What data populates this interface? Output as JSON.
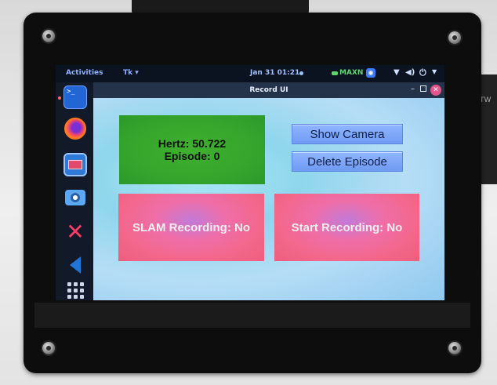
{
  "topbar": {
    "activities": "Activities",
    "app_menu": "Tk ▾",
    "clock": "Jan 31  01:21",
    "power_mode": "MAXN"
  },
  "window": {
    "title": "Record UI"
  },
  "status": {
    "hertz": "Hertz: 50.722",
    "episode": "Episode: 0"
  },
  "buttons": {
    "show_camera": "Show Camera",
    "delete_episode": "Delete Episode",
    "slam_recording": "SLAM Recording: No",
    "start_recording": "Start Recording: No"
  },
  "dock": {
    "items": [
      "terminal-icon",
      "firefox-icon",
      "system-monitor-icon",
      "camera-icon",
      "x-app-icon",
      "vscode-icon",
      "show-apps-icon"
    ]
  },
  "colors": {
    "status_panel": "#35a52c",
    "action_button": "#7fa7f8",
    "recording_button": "#f0678c",
    "content_bg": "#a4dcf1"
  },
  "device": {
    "label": "TW"
  }
}
